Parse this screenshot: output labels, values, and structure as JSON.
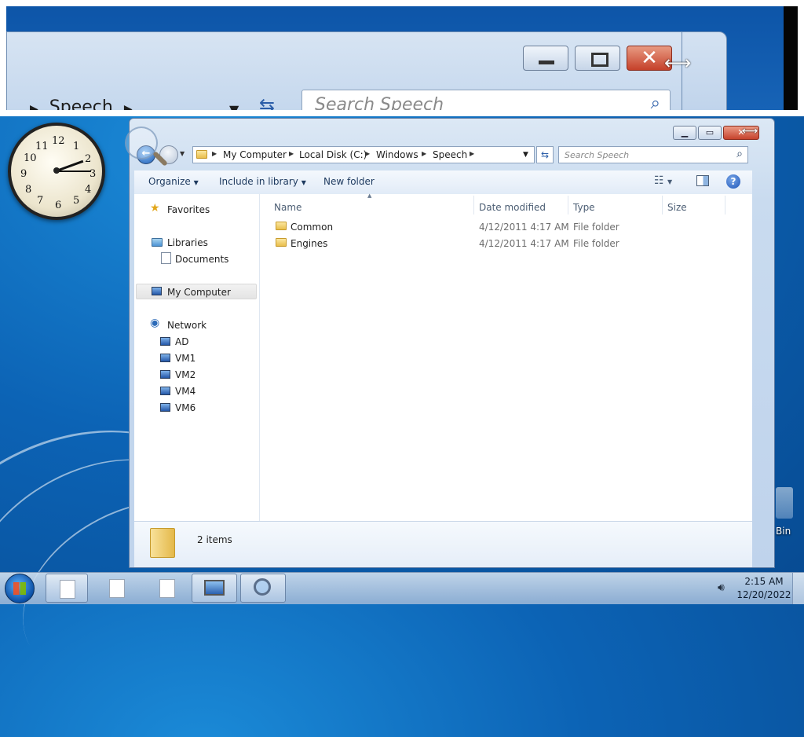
{
  "magnifier": {
    "breadcrumb_fragment": "Speech",
    "search_placeholder": "Search Speech"
  },
  "clock_gadget": {
    "numerals": [
      "12",
      "1",
      "2",
      "3",
      "4",
      "5",
      "6",
      "7",
      "8",
      "9",
      "10",
      "11"
    ],
    "time_shown": "2:15"
  },
  "window": {
    "address": {
      "crumbs": [
        "My Computer",
        "Local Disk (C:)",
        "Windows",
        "Speech"
      ]
    },
    "search_placeholder": "Search Speech",
    "toolbar": {
      "organize": "Organize",
      "include_in_library": "Include in library",
      "new_folder": "New folder",
      "help": "?"
    },
    "nav": {
      "favorites": "Favorites",
      "libraries": "Libraries",
      "documents": "Documents",
      "my_computer": "My Computer",
      "network": "Network",
      "hosts": [
        "AD",
        "VM1",
        "VM2",
        "VM4",
        "VM6"
      ]
    },
    "columns": {
      "name": "Name",
      "date_modified": "Date modified",
      "type": "Type",
      "size": "Size"
    },
    "files": [
      {
        "name": "Common",
        "date": "4/12/2011 4:17 AM",
        "type": "File folder"
      },
      {
        "name": "Engines",
        "date": "4/12/2011 4:17 AM",
        "type": "File folder"
      }
    ],
    "status": "2 items"
  },
  "desktop": {
    "recycle_bin_fragment": "Bin"
  },
  "taskbar": {
    "time": "2:15 AM",
    "date": "12/20/2022"
  },
  "colors": {
    "desktop_blue": "#0c63b5",
    "close_red": "#c6432d",
    "window_frame": "#c9dbef"
  }
}
